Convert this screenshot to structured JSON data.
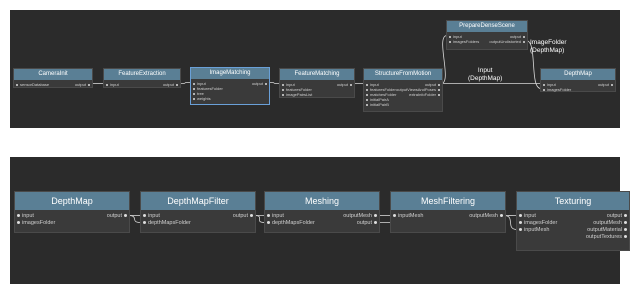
{
  "top_graph": {
    "nodes": {
      "camera_init": {
        "title": "CameraInit",
        "inputs": [
          "sensorDatabase"
        ],
        "outputs": [
          "output"
        ]
      },
      "feature_extraction": {
        "title": "FeatureExtraction",
        "inputs": [
          "input"
        ],
        "outputs": [
          "output"
        ]
      },
      "image_matching": {
        "title": "ImageMatching",
        "inputs": [
          "input",
          "featuresFolder",
          "tree",
          "weights"
        ],
        "outputs": [
          "output"
        ]
      },
      "feature_matching": {
        "title": "FeatureMatching",
        "inputs": [
          "input",
          "featuresFolder",
          "imagePairsList"
        ],
        "outputs": [
          "output"
        ]
      },
      "structure_from_motion": {
        "title": "StructureFromMotion",
        "inputs": [
          "input",
          "featuresFolder",
          "matchesFolder",
          "initialPairA",
          "initialPairB"
        ],
        "outputs": [
          "output",
          "outputViewsAndPoses",
          "extraInfoFolder"
        ]
      },
      "prepare_dense_scene": {
        "title": "PrepareDenseScene",
        "inputs": [
          "input",
          "imagesFolders"
        ],
        "outputs": [
          "output",
          "outputUndistorted"
        ]
      },
      "depth_map": {
        "title": "DepthMap",
        "inputs": [
          "input",
          "imagesFolder"
        ],
        "outputs": [
          "output"
        ]
      }
    },
    "edge_labels": {
      "image_folder": "ImageFolder\n(DepthMap)",
      "input": "Input\n(DepthMap)"
    }
  },
  "bottom_graph": {
    "nodes": {
      "depth_map": {
        "title": "DepthMap",
        "inputs": [
          "input",
          "imagesFolder"
        ],
        "outputs": [
          "output"
        ]
      },
      "depth_map_filter": {
        "title": "DepthMapFilter",
        "inputs": [
          "input",
          "depthMapsFolder"
        ],
        "outputs": [
          "output"
        ]
      },
      "meshing": {
        "title": "Meshing",
        "inputs": [
          "input",
          "depthMapsFolder"
        ],
        "outputs": [
          "outputMesh",
          "output"
        ]
      },
      "mesh_filtering": {
        "title": "MeshFiltering",
        "inputs": [
          "inputMesh"
        ],
        "outputs": [
          "outputMesh"
        ]
      },
      "texturing": {
        "title": "Texturing",
        "inputs": [
          "input",
          "imagesFolder",
          "inputMesh"
        ],
        "outputs": [
          "output",
          "outputMesh",
          "outputMaterial",
          "outputTextures"
        ]
      }
    }
  },
  "colors": {
    "background": "#2b2b2b",
    "node_header": "#5a7f95",
    "node_body": "#3a3a3a",
    "edge": "#d8d8d8",
    "selection": "#6aa0d8"
  }
}
